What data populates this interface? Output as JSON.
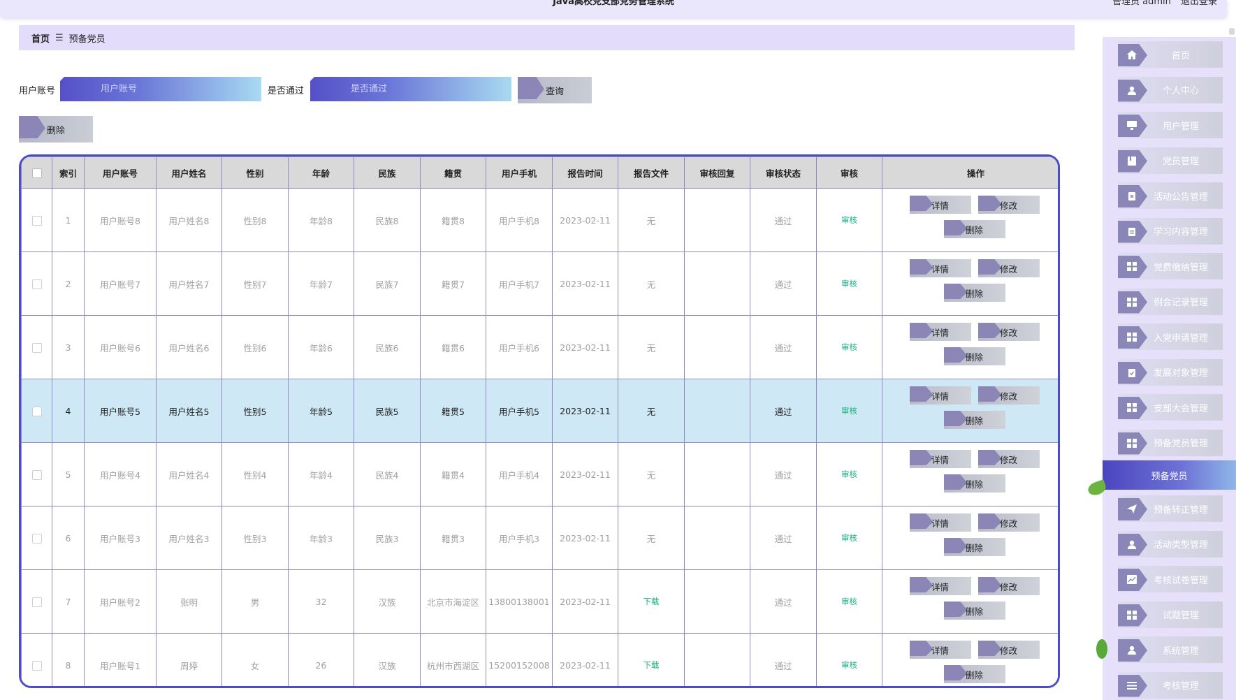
{
  "topbar": {
    "title": "Java高校党支部党务管理系统",
    "role_user": "管理员 admin",
    "logout": "退出登录"
  },
  "breadcrumb": {
    "home": "首页",
    "separator": "☰",
    "current": "预备党员"
  },
  "search": {
    "account_label": "用户账号",
    "account_placeholder": "用户账号",
    "passed_label": "是否通过",
    "passed_placeholder": "是否通过",
    "query_button": "查询",
    "delete_button": "删除"
  },
  "table": {
    "headers": [
      "索引",
      "用户账号",
      "用户姓名",
      "性别",
      "年龄",
      "民族",
      "籍贯",
      "用户手机",
      "报告时间",
      "报告文件",
      "审核回复",
      "审核状态",
      "审核",
      "操作"
    ],
    "rows": [
      {
        "idx": "1",
        "account": "用户账号8",
        "name": "用户姓名8",
        "gender": "性别8",
        "age": "年龄8",
        "nation": "民族8",
        "origin": "籍贯8",
        "phone": "用户手机8",
        "time": "2023-02-11",
        "file": "无",
        "reply": "",
        "status": "通过",
        "audit": "审核"
      },
      {
        "idx": "2",
        "account": "用户账号7",
        "name": "用户姓名7",
        "gender": "性别7",
        "age": "年龄7",
        "nation": "民族7",
        "origin": "籍贯7",
        "phone": "用户手机7",
        "time": "2023-02-11",
        "file": "无",
        "reply": "",
        "status": "通过",
        "audit": "审核"
      },
      {
        "idx": "3",
        "account": "用户账号6",
        "name": "用户姓名6",
        "gender": "性别6",
        "age": "年龄6",
        "nation": "民族6",
        "origin": "籍贯6",
        "phone": "用户手机6",
        "time": "2023-02-11",
        "file": "无",
        "reply": "",
        "status": "通过",
        "audit": "审核"
      },
      {
        "idx": "4",
        "account": "用户账号5",
        "name": "用户姓名5",
        "gender": "性别5",
        "age": "年龄5",
        "nation": "民族5",
        "origin": "籍贯5",
        "phone": "用户手机5",
        "time": "2023-02-11",
        "file": "无",
        "reply": "",
        "status": "通过",
        "audit": "审核"
      },
      {
        "idx": "5",
        "account": "用户账号4",
        "name": "用户姓名4",
        "gender": "性别4",
        "age": "年龄4",
        "nation": "民族4",
        "origin": "籍贯4",
        "phone": "用户手机4",
        "time": "2023-02-11",
        "file": "无",
        "reply": "",
        "status": "通过",
        "audit": "审核"
      },
      {
        "idx": "6",
        "account": "用户账号3",
        "name": "用户姓名3",
        "gender": "性别3",
        "age": "年龄3",
        "nation": "民族3",
        "origin": "籍贯3",
        "phone": "用户手机3",
        "time": "2023-02-11",
        "file": "无",
        "reply": "",
        "status": "通过",
        "audit": "审核"
      },
      {
        "idx": "7",
        "account": "用户账号2",
        "name": "张明",
        "gender": "男",
        "age": "32",
        "nation": "汉族",
        "origin": "北京市海淀区",
        "phone": "13800138001",
        "time": "2023-02-11",
        "file": "下载",
        "reply": "",
        "status": "通过",
        "audit": "审核"
      },
      {
        "idx": "8",
        "account": "用户账号1",
        "name": "周婷",
        "gender": "女",
        "age": "26",
        "nation": "汉族",
        "origin": "杭州市西湖区",
        "phone": "15200152008",
        "time": "2023-02-11",
        "file": "下载",
        "reply": "",
        "status": "通过",
        "audit": "审核"
      }
    ],
    "ops": {
      "detail": "详情",
      "edit": "修改",
      "delete": "删除"
    }
  },
  "sidebar": {
    "items": [
      {
        "label": "首页",
        "icon": "home-icon"
      },
      {
        "label": "个人中心",
        "icon": "person-icon"
      },
      {
        "label": "用户管理",
        "icon": "monitor-icon"
      },
      {
        "label": "党员管理",
        "icon": "book-icon"
      },
      {
        "label": "活动公告管理",
        "icon": "clipboard-x-icon"
      },
      {
        "label": "学习内容管理",
        "icon": "clipboard-icon"
      },
      {
        "label": "党费缴纳管理",
        "icon": "grid-icon"
      },
      {
        "label": "例会记录管理",
        "icon": "grid-icon"
      },
      {
        "label": "入党申请管理",
        "icon": "grid-icon"
      },
      {
        "label": "发展对象管理",
        "icon": "clipboard-check-icon"
      },
      {
        "label": "支部大会管理",
        "icon": "grid-icon"
      },
      {
        "label": "预备党员管理",
        "icon": "grid-icon"
      }
    ],
    "active": "预备党员",
    "items_after": [
      {
        "label": "预备转正管理",
        "icon": "send-icon"
      },
      {
        "label": "活动类型管理",
        "icon": "person-icon"
      },
      {
        "label": "考核试卷管理",
        "icon": "chart-icon"
      },
      {
        "label": "试题管理",
        "icon": "grid-icon"
      },
      {
        "label": "系统管理",
        "icon": "person-icon"
      },
      {
        "label": "考核管理",
        "icon": "list-icon"
      }
    ]
  },
  "colors": {
    "accent": "#4b4dc8",
    "highlight_row": "#cfe8f6",
    "sidebar_bg": "#e6e0fb",
    "link_green": "#13b57a"
  }
}
